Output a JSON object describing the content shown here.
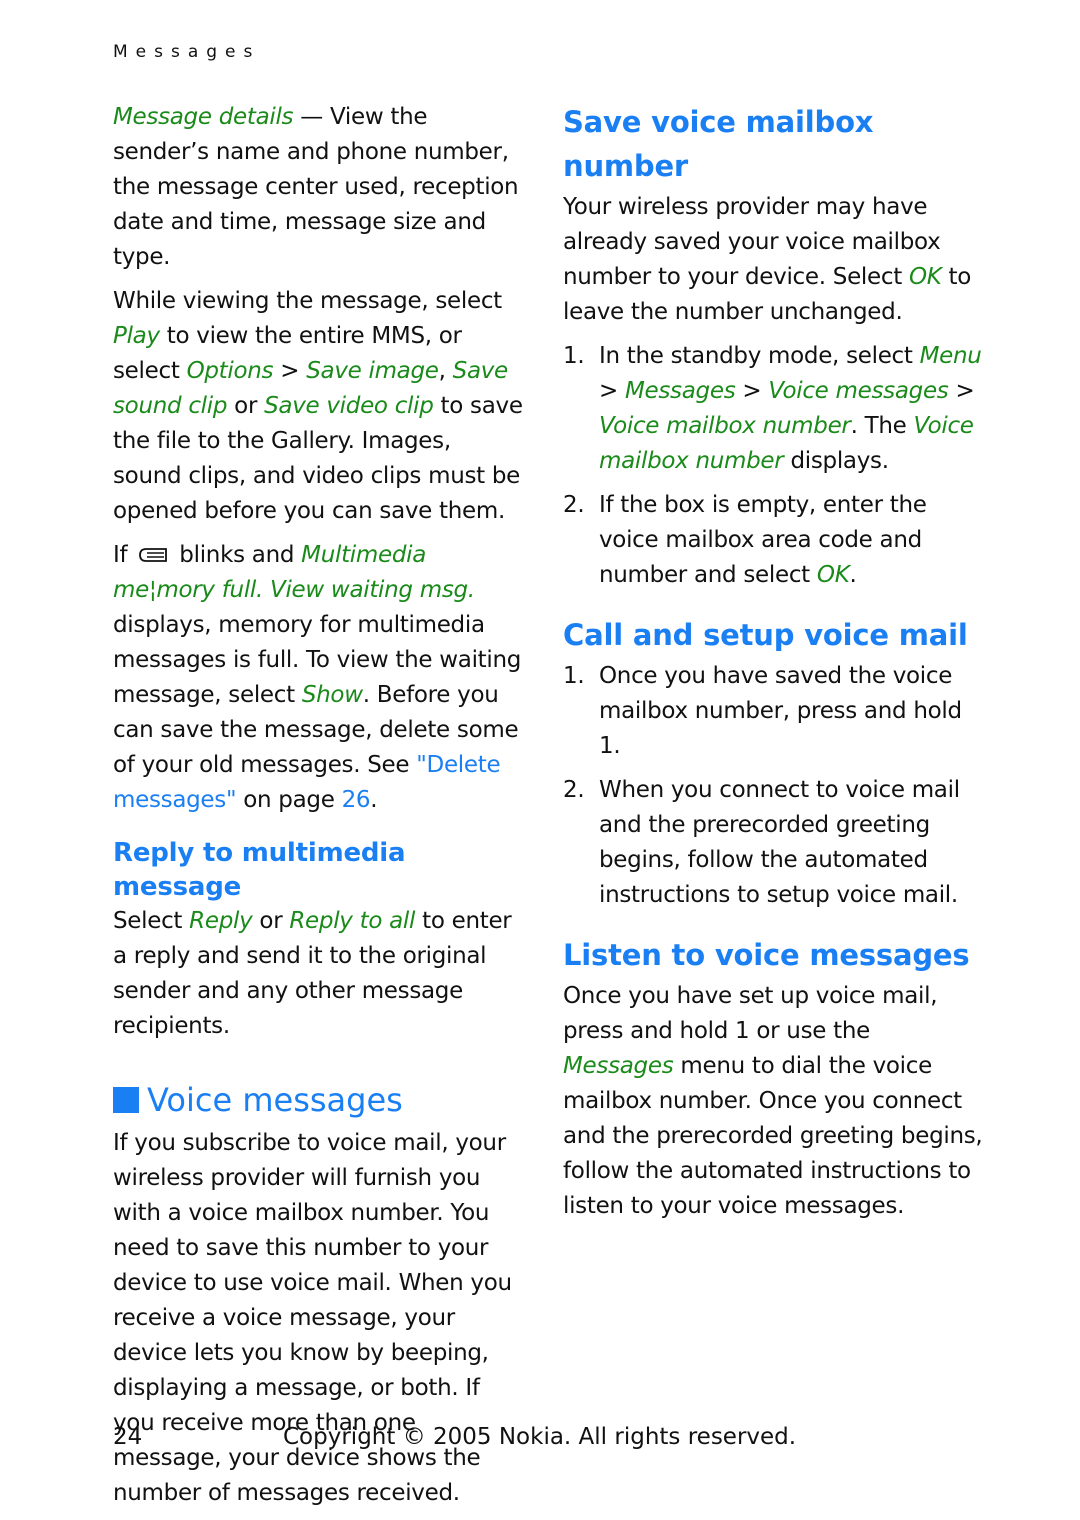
{
  "running_head": "Messages",
  "left": {
    "p1": {
      "link": "Message details",
      "text": " — View the sender’s name and phone number, the message center used, reception date and time, message size and type."
    },
    "p2": {
      "t1": "While viewing the message, select ",
      "play": "Play",
      "t2": " to view the entire MMS, or select ",
      "options": "Options",
      "sep1": " > ",
      "save_image": "Save image",
      "t3": ", ",
      "save_sound": "Save sound clip",
      "t4": " or ",
      "save_video": "Save video clip",
      "t5": " to save the file to the Gallery. Images, sound clips, and video clips must be opened before you can save them."
    },
    "p3": {
      "t1": "If ",
      "icon": "multimedia-message-icon",
      "t2": " blinks and ",
      "g1": "Multimedia me¦mory full. View waiting msg.",
      "t3": " displays, memory for multimedia messages is full. To view the waiting message, select ",
      "show": "Show",
      "t4": ". Before you can save the message, delete some of your old messages. See ",
      "link": "\"Delete messages\"",
      "t5": " on page ",
      "page": "26",
      "t6": "."
    },
    "reply_heading": "Reply to multimedia message",
    "reply": {
      "t1": "Select ",
      "reply": "Reply",
      "t2": " or ",
      "reply_all": "Reply to all",
      "t3": " to enter a reply and send it to the original sender and any other message recipients."
    },
    "voice_heading": "Voice messages",
    "voice_text": "If you subscribe to voice mail, your wireless provider will furnish you with a voice mailbox number. You need to save this number to your device to use voice mail. When you receive a voice message, your device lets you know by beeping, displaying a message, or both. If you receive more than one message, your device shows the number of messages received."
  },
  "right": {
    "save_heading": "Save voice mailbox number",
    "save_text": {
      "t1": "Your wireless provider may have already saved your voice mailbox number to your device. Select ",
      "ok": "OK",
      "t2": " to leave the number unchanged."
    },
    "save_steps": [
      {
        "num": "1.",
        "t1": "In the standby mode, select ",
        "menu": "Menu",
        "sep": " > ",
        "messages": "Messages",
        "voice_messages": "Voice messages",
        "vmn": "Voice mailbox number",
        "t2": ". The ",
        "vmn2": "Voice mailbox number",
        "t3": " displays."
      },
      {
        "num": "2.",
        "t1": "If the box is empty, enter the voice mailbox area code and number and select ",
        "ok": "OK",
        "t2": "."
      }
    ],
    "call_heading": "Call and setup voice mail",
    "call_steps": [
      {
        "num": "1.",
        "text": "Once you have saved the voice mailbox number, press and hold 1."
      },
      {
        "num": "2.",
        "text": "When you connect to voice mail and the prerecorded greeting begins, follow the automated instructions to setup voice mail."
      }
    ],
    "listen_heading": "Listen to voice messages",
    "listen": {
      "t1": "Once you have set up voice mail, press and hold 1 or use the ",
      "messages": "Messages",
      "t2": " menu to dial the voice mailbox number. Once you connect and the prerecorded greeting begins, follow the automated instructions to listen to your voice messages."
    }
  },
  "footer": {
    "page_number": "24",
    "copyright": "Copyright © 2005 Nokia. All rights reserved."
  },
  "colors": {
    "link_green": "#1a8a1a",
    "heading_blue": "#1a7ff2",
    "text": "#111111"
  }
}
